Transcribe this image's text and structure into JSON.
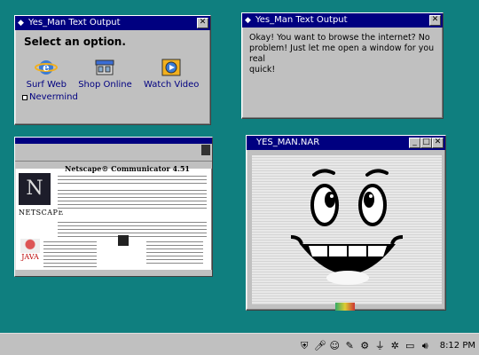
{
  "windows": {
    "options": {
      "title": "Yes_Man Text Output",
      "heading": "Select an option.",
      "options": [
        {
          "label": "Surf Web",
          "icon": "internet-explorer-icon"
        },
        {
          "label": "Shop Online",
          "icon": "shop-icon"
        },
        {
          "label": "Watch Video",
          "icon": "video-icon"
        }
      ],
      "nevermind": "Nevermind"
    },
    "message": {
      "title": "Yes_Man Text Output",
      "text": "Okay! You want to browse the internet? No\nproblem! Just let me open a window for you real\nquick!"
    },
    "netscape": {
      "heading": "Netscape® Communicator 4.51",
      "logo": "N",
      "brand": "NETSCAPE",
      "java": "JAVA"
    },
    "yesman": {
      "title": "YES_MAN.NAR"
    }
  },
  "taskbar": {
    "time": "8:12 PM"
  },
  "colors": {
    "desktop": "#0f7f7f",
    "titlebar": "#000080"
  }
}
